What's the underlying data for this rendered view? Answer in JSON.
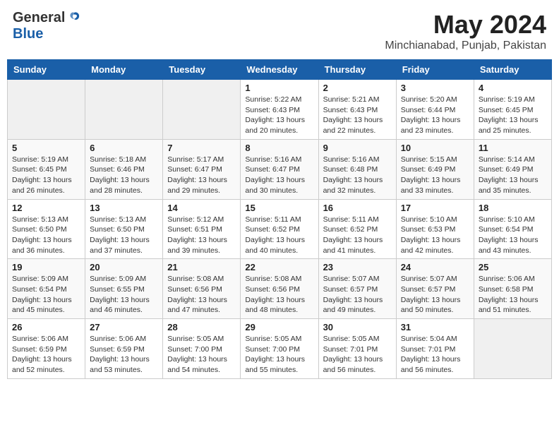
{
  "header": {
    "logo_general": "General",
    "logo_blue": "Blue",
    "month_title": "May 2024",
    "location": "Minchianabad, Punjab, Pakistan"
  },
  "weekdays": [
    "Sunday",
    "Monday",
    "Tuesday",
    "Wednesday",
    "Thursday",
    "Friday",
    "Saturday"
  ],
  "weeks": [
    [
      {
        "day": "",
        "info": ""
      },
      {
        "day": "",
        "info": ""
      },
      {
        "day": "",
        "info": ""
      },
      {
        "day": "1",
        "info": "Sunrise: 5:22 AM\nSunset: 6:43 PM\nDaylight: 13 hours\nand 20 minutes."
      },
      {
        "day": "2",
        "info": "Sunrise: 5:21 AM\nSunset: 6:43 PM\nDaylight: 13 hours\nand 22 minutes."
      },
      {
        "day": "3",
        "info": "Sunrise: 5:20 AM\nSunset: 6:44 PM\nDaylight: 13 hours\nand 23 minutes."
      },
      {
        "day": "4",
        "info": "Sunrise: 5:19 AM\nSunset: 6:45 PM\nDaylight: 13 hours\nand 25 minutes."
      }
    ],
    [
      {
        "day": "5",
        "info": "Sunrise: 5:19 AM\nSunset: 6:45 PM\nDaylight: 13 hours\nand 26 minutes."
      },
      {
        "day": "6",
        "info": "Sunrise: 5:18 AM\nSunset: 6:46 PM\nDaylight: 13 hours\nand 28 minutes."
      },
      {
        "day": "7",
        "info": "Sunrise: 5:17 AM\nSunset: 6:47 PM\nDaylight: 13 hours\nand 29 minutes."
      },
      {
        "day": "8",
        "info": "Sunrise: 5:16 AM\nSunset: 6:47 PM\nDaylight: 13 hours\nand 30 minutes."
      },
      {
        "day": "9",
        "info": "Sunrise: 5:16 AM\nSunset: 6:48 PM\nDaylight: 13 hours\nand 32 minutes."
      },
      {
        "day": "10",
        "info": "Sunrise: 5:15 AM\nSunset: 6:49 PM\nDaylight: 13 hours\nand 33 minutes."
      },
      {
        "day": "11",
        "info": "Sunrise: 5:14 AM\nSunset: 6:49 PM\nDaylight: 13 hours\nand 35 minutes."
      }
    ],
    [
      {
        "day": "12",
        "info": "Sunrise: 5:13 AM\nSunset: 6:50 PM\nDaylight: 13 hours\nand 36 minutes."
      },
      {
        "day": "13",
        "info": "Sunrise: 5:13 AM\nSunset: 6:50 PM\nDaylight: 13 hours\nand 37 minutes."
      },
      {
        "day": "14",
        "info": "Sunrise: 5:12 AM\nSunset: 6:51 PM\nDaylight: 13 hours\nand 39 minutes."
      },
      {
        "day": "15",
        "info": "Sunrise: 5:11 AM\nSunset: 6:52 PM\nDaylight: 13 hours\nand 40 minutes."
      },
      {
        "day": "16",
        "info": "Sunrise: 5:11 AM\nSunset: 6:52 PM\nDaylight: 13 hours\nand 41 minutes."
      },
      {
        "day": "17",
        "info": "Sunrise: 5:10 AM\nSunset: 6:53 PM\nDaylight: 13 hours\nand 42 minutes."
      },
      {
        "day": "18",
        "info": "Sunrise: 5:10 AM\nSunset: 6:54 PM\nDaylight: 13 hours\nand 43 minutes."
      }
    ],
    [
      {
        "day": "19",
        "info": "Sunrise: 5:09 AM\nSunset: 6:54 PM\nDaylight: 13 hours\nand 45 minutes."
      },
      {
        "day": "20",
        "info": "Sunrise: 5:09 AM\nSunset: 6:55 PM\nDaylight: 13 hours\nand 46 minutes."
      },
      {
        "day": "21",
        "info": "Sunrise: 5:08 AM\nSunset: 6:56 PM\nDaylight: 13 hours\nand 47 minutes."
      },
      {
        "day": "22",
        "info": "Sunrise: 5:08 AM\nSunset: 6:56 PM\nDaylight: 13 hours\nand 48 minutes."
      },
      {
        "day": "23",
        "info": "Sunrise: 5:07 AM\nSunset: 6:57 PM\nDaylight: 13 hours\nand 49 minutes."
      },
      {
        "day": "24",
        "info": "Sunrise: 5:07 AM\nSunset: 6:57 PM\nDaylight: 13 hours\nand 50 minutes."
      },
      {
        "day": "25",
        "info": "Sunrise: 5:06 AM\nSunset: 6:58 PM\nDaylight: 13 hours\nand 51 minutes."
      }
    ],
    [
      {
        "day": "26",
        "info": "Sunrise: 5:06 AM\nSunset: 6:59 PM\nDaylight: 13 hours\nand 52 minutes."
      },
      {
        "day": "27",
        "info": "Sunrise: 5:06 AM\nSunset: 6:59 PM\nDaylight: 13 hours\nand 53 minutes."
      },
      {
        "day": "28",
        "info": "Sunrise: 5:05 AM\nSunset: 7:00 PM\nDaylight: 13 hours\nand 54 minutes."
      },
      {
        "day": "29",
        "info": "Sunrise: 5:05 AM\nSunset: 7:00 PM\nDaylight: 13 hours\nand 55 minutes."
      },
      {
        "day": "30",
        "info": "Sunrise: 5:05 AM\nSunset: 7:01 PM\nDaylight: 13 hours\nand 56 minutes."
      },
      {
        "day": "31",
        "info": "Sunrise: 5:04 AM\nSunset: 7:01 PM\nDaylight: 13 hours\nand 56 minutes."
      },
      {
        "day": "",
        "info": ""
      }
    ]
  ]
}
